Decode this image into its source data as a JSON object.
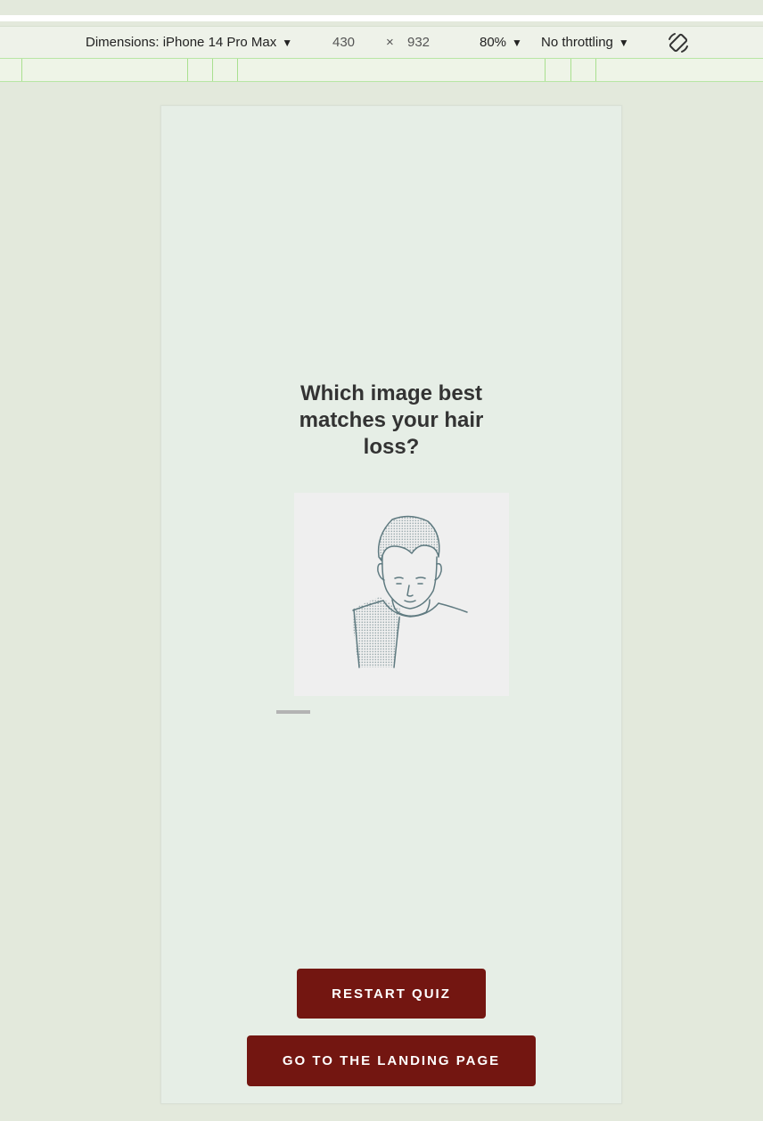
{
  "devtools": {
    "dimensions_label": "Dimensions: iPhone 14 Pro Max",
    "width": "430",
    "times": "×",
    "height": "932",
    "zoom": "80%",
    "throttling": "No throttling",
    "caret": "▼"
  },
  "quiz": {
    "question": "Which image best matches your hair loss?",
    "restart_label": "RESTART QUIZ",
    "landing_label": "GO TO THE LANDING PAGE"
  },
  "colors": {
    "page_bg": "#e3e9dc",
    "phone_bg": "#e6eee6",
    "button_bg": "#731611",
    "image_bg": "#efefef",
    "illustration_stroke": "#5f7a80"
  },
  "icons": [
    "rotate-icon",
    "dropdown-caret-icon"
  ]
}
